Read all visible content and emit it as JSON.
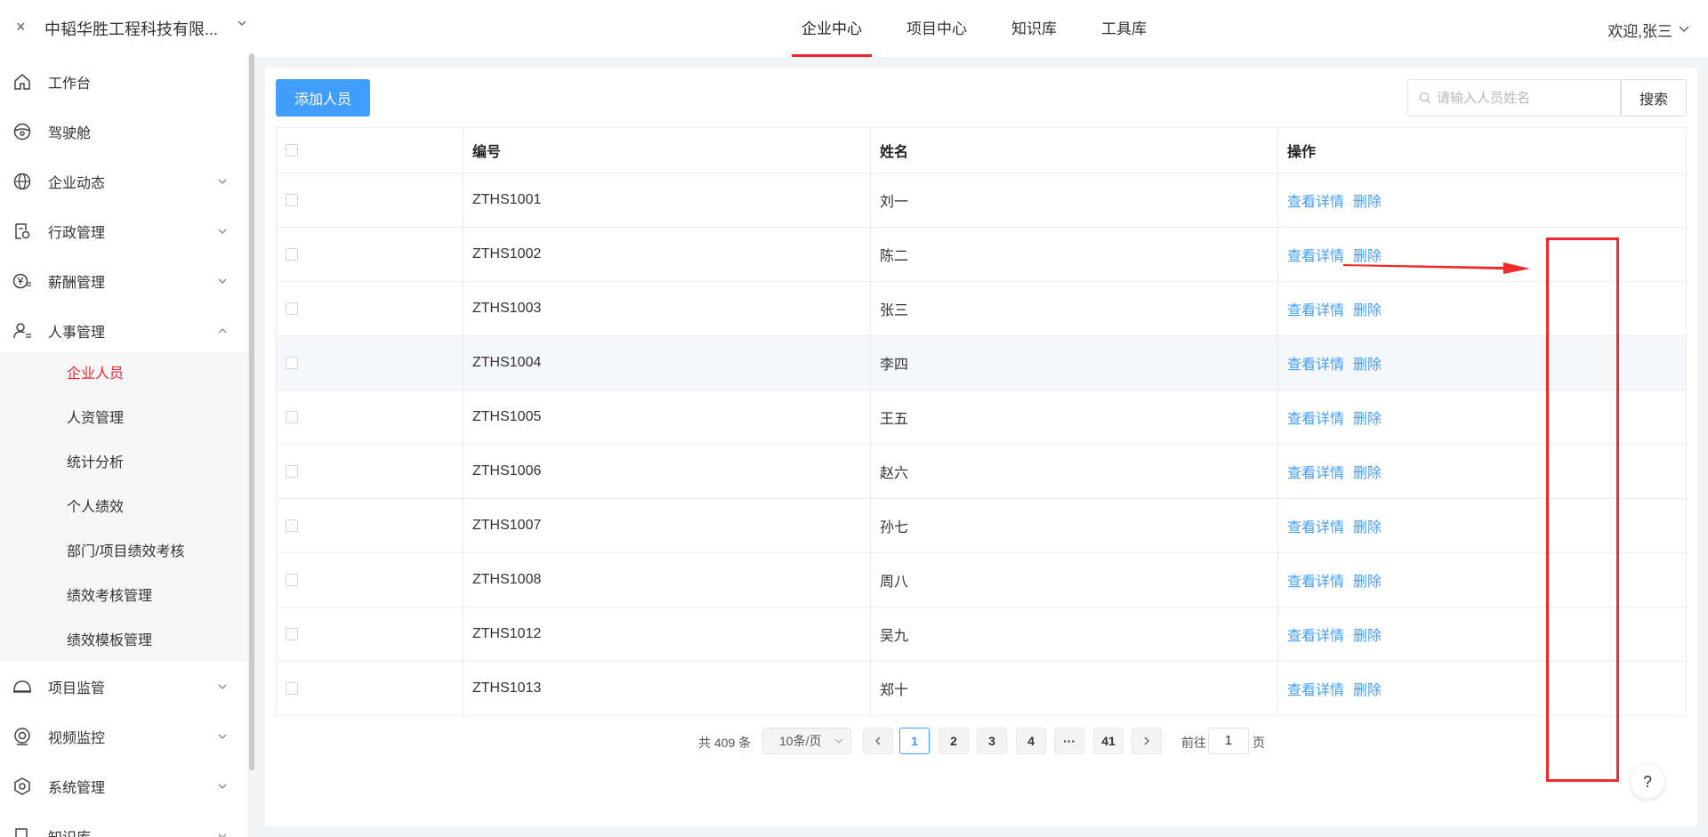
{
  "header": {
    "close_glyph": "×",
    "company": "中韬华胜工程科技有限...",
    "nav": [
      {
        "label": "企业中心",
        "active": true
      },
      {
        "label": "项目中心",
        "active": false
      },
      {
        "label": "知识库",
        "active": false
      },
      {
        "label": "工具库",
        "active": false
      }
    ],
    "welcome": "欢迎,张三"
  },
  "sidebar": {
    "items": [
      {
        "label": "工作台",
        "icon": "home-icon",
        "expandable": false
      },
      {
        "label": "驾驶舱",
        "icon": "steering-wheel-icon",
        "expandable": false
      },
      {
        "label": "企业动态",
        "icon": "globe-icon",
        "expandable": true
      },
      {
        "label": "行政管理",
        "icon": "document-gear-icon",
        "expandable": true
      },
      {
        "label": "薪酬管理",
        "icon": "yen-list-icon",
        "expandable": true
      },
      {
        "label": "人事管理",
        "icon": "user-list-icon",
        "expandable": true,
        "expanded": true
      },
      {
        "label": "项目监管",
        "icon": "helmet-icon",
        "expandable": true
      },
      {
        "label": "视频监控",
        "icon": "camera-icon",
        "expandable": true
      },
      {
        "label": "系统管理",
        "icon": "hexagon-gear-icon",
        "expandable": true
      },
      {
        "label": "知识库",
        "icon": "book-icon",
        "expandable": true
      }
    ],
    "subitems": [
      {
        "label": "企业人员",
        "active": true
      },
      {
        "label": "人资管理",
        "active": false
      },
      {
        "label": "统计分析",
        "active": false
      },
      {
        "label": "个人绩效",
        "active": false
      },
      {
        "label": "部门/项目绩效考核",
        "active": false
      },
      {
        "label": "绩效考核管理",
        "active": false
      },
      {
        "label": "绩效模板管理",
        "active": false
      }
    ]
  },
  "toolbar": {
    "add_label": "添加人员",
    "search_placeholder": "请输入人员姓名",
    "search_label": "搜索"
  },
  "table": {
    "headers": {
      "id": "编号",
      "name": "姓名",
      "action": "操作"
    },
    "action_view": "查看详情",
    "action_delete": "删除",
    "rows": [
      {
        "id": "ZTHS1001",
        "name": "刘一"
      },
      {
        "id": "ZTHS1002",
        "name": "陈二"
      },
      {
        "id": "ZTHS1003",
        "name": "张三"
      },
      {
        "id": "ZTHS1004",
        "name": "李四"
      },
      {
        "id": "ZTHS1005",
        "name": "王五"
      },
      {
        "id": "ZTHS1006",
        "name": "赵六"
      },
      {
        "id": "ZTHS1007",
        "name": "孙七"
      },
      {
        "id": "ZTHS1008",
        "name": "周八"
      },
      {
        "id": "ZTHS1012",
        "name": "吴九"
      },
      {
        "id": "ZTHS1013",
        "name": "郑十"
      }
    ]
  },
  "pagination": {
    "total": "共 409 条",
    "page_size": "10条/页",
    "pages": [
      "1",
      "2",
      "3",
      "4",
      "···",
      "41"
    ],
    "current": "1",
    "goto_prefix": "前往",
    "goto_value": "1",
    "goto_suffix": "页"
  },
  "help_glyph": "?",
  "colors": {
    "accent": "#409eff",
    "active_red": "#f5222d",
    "annotation_red": "#f02a2a"
  }
}
